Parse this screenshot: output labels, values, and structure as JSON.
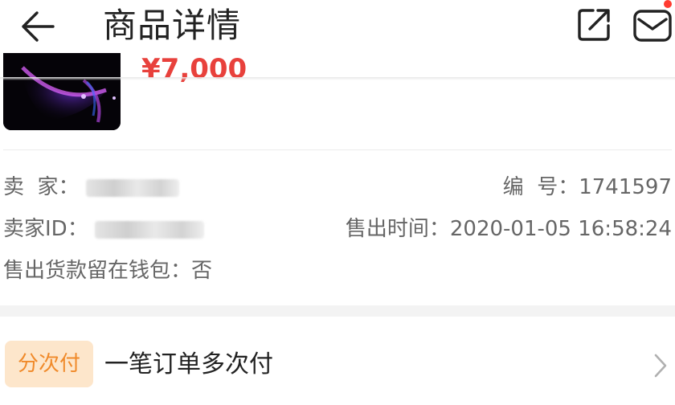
{
  "header": {
    "title": "商品详情",
    "back_icon": "arrow-left-icon",
    "share_icon": "share-icon",
    "mail_icon": "mail-icon",
    "notification_color": "#ff3b30"
  },
  "product": {
    "price": "¥7,000",
    "price_color": "#e8413c"
  },
  "info": {
    "seller_label": "卖  家：",
    "seller_id_label": "卖家ID：",
    "wallet_label": "售出货款留在钱包：",
    "wallet_value": "否",
    "number_label": "编  号：",
    "number_value": "1741597",
    "sold_time_label": "售出时间：",
    "sold_time_value": "2020-01-05 16:58:24"
  },
  "installment": {
    "badge": "分次付",
    "text": "一笔订单多次付",
    "chevron_icon": "chevron-right-icon",
    "badge_bg": "#fde6cb",
    "badge_color": "#f08a2a"
  }
}
